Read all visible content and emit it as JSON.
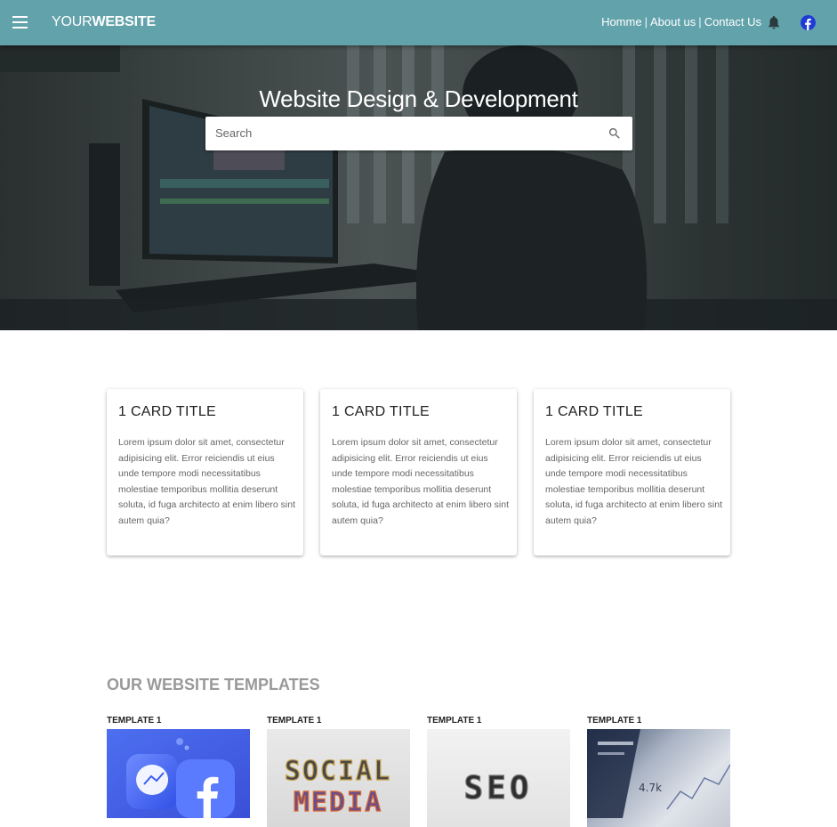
{
  "appbar": {
    "brand_light": "YOUR",
    "brand_bold": "WEBSITE",
    "nav": [
      "Homme",
      "About us",
      "Contact Us"
    ],
    "separator": "|"
  },
  "hero": {
    "title": "Website Design & Development",
    "search_placeholder": "Search"
  },
  "cards": [
    {
      "title": "1 CARD TITLE",
      "text": "Lorem ipsum dolor sit amet, consectetur adipisicing elit. Error reiciendis ut eius unde tempore modi necessitatibus molestiae temporibus mollitia deserunt soluta, id fuga architecto at enim libero sint autem quia?"
    },
    {
      "title": "1 CARD TITLE",
      "text": "Lorem ipsum dolor sit amet, consectetur adipisicing elit. Error reiciendis ut eius unde tempore modi necessitatibus molestiae temporibus mollitia deserunt soluta, id fuga architecto at enim libero sint autem quia?"
    },
    {
      "title": "1 CARD TITLE",
      "text": "Lorem ipsum dolor sit amet, consectetur adipisicing elit. Error reiciendis ut eius unde tempore modi necessitatibus molestiae temporibus mollitia deserunt soluta, id fuga architecto at enim libero sint autem quia?"
    }
  ],
  "templates": {
    "title": "OUR WEBSITE TEMPLATES",
    "items": [
      {
        "label": "TEMPLATE 1",
        "image": "messenger-facebook-3d-icons"
      },
      {
        "label": "TEMPLATE 1",
        "image": "social-media-letters",
        "img_text_1": "SOCIAL",
        "img_text_2": "MEDIA"
      },
      {
        "label": "TEMPLATE 1",
        "image": "seo-letters",
        "img_text_1": "SEO"
      },
      {
        "label": "TEMPLATE 1",
        "image": "analytics-dashboard-screen",
        "img_text_1": "4.7k"
      }
    ]
  },
  "colors": {
    "appbar": "#62a2ab",
    "facebook": "#1f3bd6",
    "section_title": "#999999"
  },
  "icons": [
    "menu-icon",
    "bell-icon",
    "facebook-icon",
    "search-icon"
  ]
}
